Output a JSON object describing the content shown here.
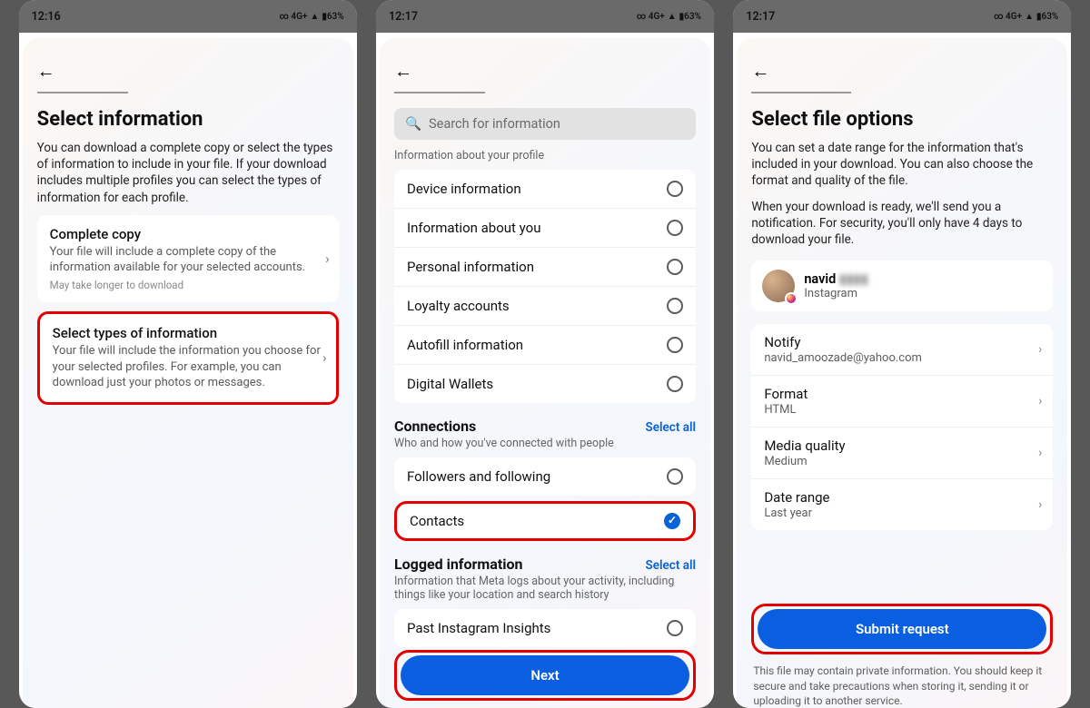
{
  "screens": [
    {
      "statusbar": {
        "time": "12:16",
        "network": "∞ 4G+",
        "signal": "▲",
        "battery": "▮63%"
      },
      "title": "Select information",
      "desc": "You can download a complete copy or select the types of information to include in your file. If your download includes multiple profiles you can select the types of information for each profile.",
      "option_a": {
        "title": "Complete copy",
        "sub": "Your file will include a complete copy of the information available for your selected accounts.",
        "hint": "May take longer to download"
      },
      "option_b": {
        "title": "Select types of information",
        "sub": "Your file will include the information you choose for your selected profiles. For example, you can download just your photos or messages."
      }
    },
    {
      "statusbar": {
        "time": "12:17",
        "network": "∞ 4G+",
        "signal": "▲",
        "battery": "▮63%"
      },
      "search_placeholder": "Search for information",
      "profile_section_label": "Information about your profile",
      "profile_items": [
        "Device information",
        "Information about you",
        "Personal information",
        "Loyalty accounts",
        "Autofill information",
        "Digital Wallets"
      ],
      "connections": {
        "title": "Connections",
        "select_all": "Select all",
        "sub": "Who and how you've connected with people",
        "items": [
          "Followers and following",
          "Contacts"
        ],
        "selected_item": "Contacts"
      },
      "logged": {
        "title": "Logged information",
        "select_all": "Select all",
        "sub": "Information that Meta logs about your activity, including things like your location and search history",
        "items": [
          "Past Instagram Insights"
        ]
      },
      "next_label": "Next"
    },
    {
      "statusbar": {
        "time": "12:17",
        "network": "∞ 4G+",
        "signal": "▲",
        "battery": "▮63%"
      },
      "title": "Select file options",
      "desc1": "You can set a date range for the information that's included in your download. You can also choose the format and quality of the file.",
      "desc2": "When your download is ready, we'll send you a notification. For security, you'll only have 4 days to download your file.",
      "account": {
        "name": "navid",
        "name_blur": "▮▮▮▮",
        "platform": "Instagram"
      },
      "options": [
        {
          "label": "Notify",
          "value": "navid_amoozade@yahoo.com"
        },
        {
          "label": "Format",
          "value": "HTML"
        },
        {
          "label": "Media quality",
          "value": "Medium"
        },
        {
          "label": "Date range",
          "value": "Last year"
        }
      ],
      "submit_label": "Submit request",
      "footnote": "This file may contain private information. You should keep it secure and take precautions when storing it, sending it or uploading it to another service."
    }
  ]
}
